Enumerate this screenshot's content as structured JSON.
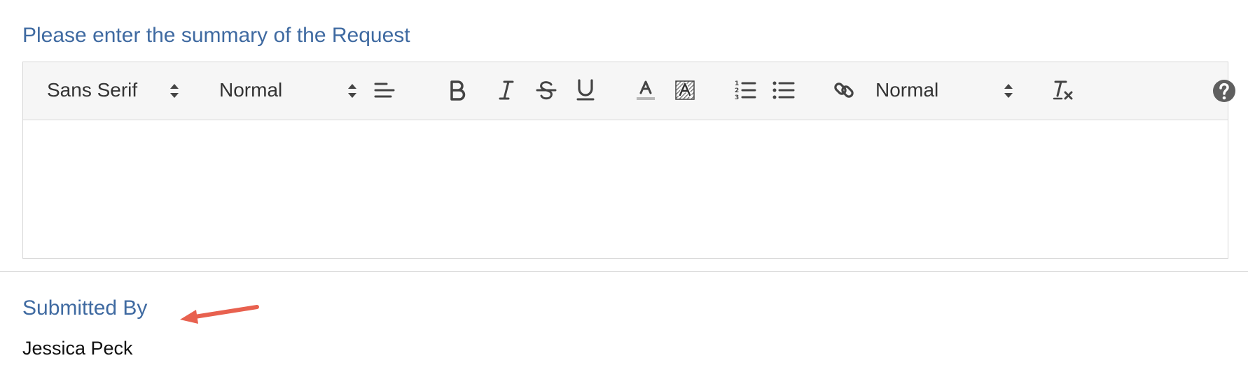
{
  "summary_field": {
    "label": "Please enter the summary of the Request",
    "content": ""
  },
  "toolbar": {
    "font_picker": "Sans Serif",
    "size_picker": "Normal",
    "header_picker": "Normal",
    "buttons": [
      "align-left-icon",
      "bold-icon",
      "italic-icon",
      "strike-icon",
      "underline-icon",
      "text-color-icon",
      "background-color-icon",
      "ordered-list-icon",
      "bullet-list-icon",
      "link-icon",
      "clear-format-icon",
      "help-icon"
    ]
  },
  "submitted_by": {
    "label": "Submitted By",
    "value": "Jessica Peck"
  },
  "colors": {
    "label_blue": "#3f6aa1",
    "toolbar_bg": "#f6f6f6",
    "annotation_arrow": "#e8614f"
  }
}
